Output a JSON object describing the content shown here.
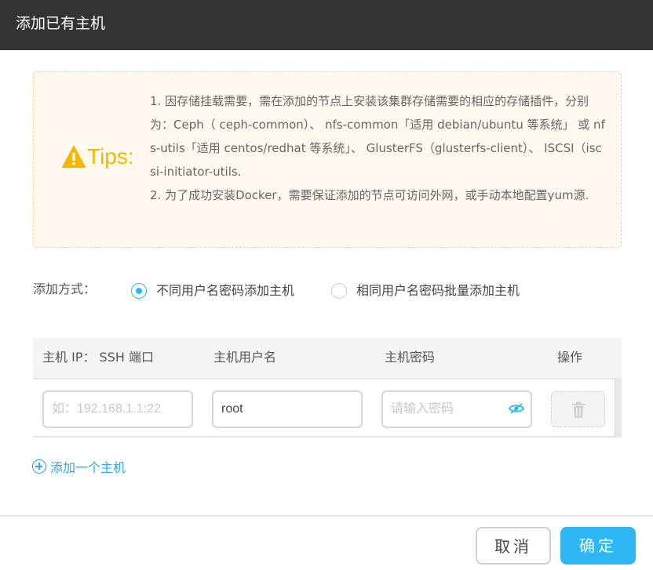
{
  "dialog": {
    "title": "添加已有主机"
  },
  "tips": {
    "label": "Tips:",
    "text_line1": "1. 因存储挂载需要，需在添加的节点上安装该集群存储需要的相应的存储插件，分别为：Ceph（ ceph-common）、 nfs-common「适用 debian/ubuntu 等系统」 或 nfs-utils「适用 centos/redhat 等系统」、 GlusterFS（glusterfs-client）、 ISCSI（iscsi-initiator-utils.",
    "text_line2": "2. 为了成功安装Docker，需要保证添加的节点可访问外网，或手动本地配置yum源.",
    "accent_color": "#f5b700"
  },
  "add_method": {
    "label": "添加方式：",
    "options": [
      {
        "label": "不同用户名密码添加主机",
        "checked": true
      },
      {
        "label": "相同用户名密码批量添加主机",
        "checked": false
      }
    ]
  },
  "table": {
    "headers": [
      "主机 IP： SSH 端口",
      "主机用户名",
      "主机密码",
      "操作"
    ],
    "rows": [
      {
        "ip_placeholder": "如：192.168.1.1:22",
        "username_value": "root",
        "password_placeholder": "请输入密码"
      }
    ]
  },
  "add_host_label": "添加一个主机",
  "footer": {
    "cancel_label": "取消",
    "ok_label": "确定"
  },
  "colors": {
    "primary": "#2db7f5",
    "header_bg": "#333333",
    "tips_bg": "#fef8ee"
  },
  "icons": [
    "warning-icon",
    "eye-icon",
    "trash-icon",
    "plus-circle-icon"
  ]
}
